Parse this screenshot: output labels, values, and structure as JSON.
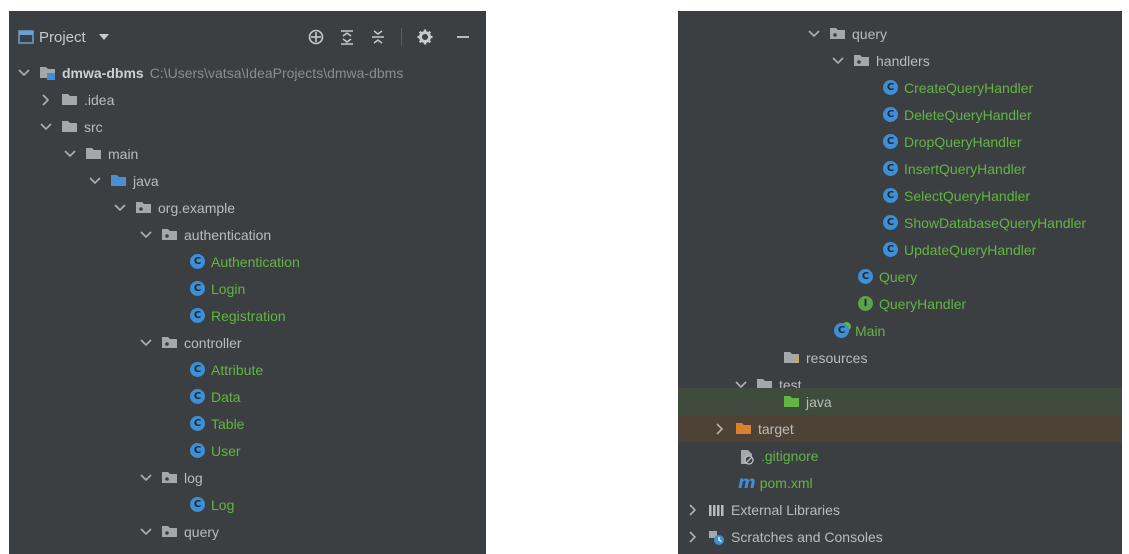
{
  "left": {
    "toolbar": {
      "title": "Project",
      "icons": [
        "project-view-icon",
        "dropdown-arrow-icon",
        "locate-icon",
        "expand-all-icon",
        "collapse-all-icon",
        "gear-icon",
        "minimize-icon"
      ]
    },
    "rows": [
      {
        "label": "dmwa-dbms",
        "path": "C:\\Users\\vatsa\\IdeaProjects\\dmwa-dbms"
      },
      {
        "label": ".idea"
      },
      {
        "label": "src"
      },
      {
        "label": "main"
      },
      {
        "label": "java"
      },
      {
        "label": "org.example"
      },
      {
        "label": "authentication"
      },
      {
        "label": "Authentication"
      },
      {
        "label": "Login"
      },
      {
        "label": "Registration"
      },
      {
        "label": "controller"
      },
      {
        "label": "Attribute"
      },
      {
        "label": "Data"
      },
      {
        "label": "Table"
      },
      {
        "label": "User"
      },
      {
        "label": "log"
      },
      {
        "label": "Log"
      },
      {
        "label": "query"
      }
    ]
  },
  "right": {
    "rows": [
      {
        "label": "query"
      },
      {
        "label": "handlers"
      },
      {
        "label": "CreateQueryHandler"
      },
      {
        "label": "DeleteQueryHandler"
      },
      {
        "label": "DropQueryHandler"
      },
      {
        "label": "InsertQueryHandler"
      },
      {
        "label": "SelectQueryHandler"
      },
      {
        "label": "ShowDatabaseQueryHandler"
      },
      {
        "label": "UpdateQueryHandler"
      },
      {
        "label": "Query"
      },
      {
        "label": "QueryHandler"
      },
      {
        "label": "Main"
      },
      {
        "label": "resources"
      },
      {
        "label": "test"
      },
      {
        "label": "java"
      },
      {
        "label": "target"
      },
      {
        "label": ".gitignore"
      },
      {
        "label": "pom.xml"
      },
      {
        "label": "External Libraries"
      },
      {
        "label": "Scratches and Consoles"
      }
    ]
  },
  "colors": {
    "panel_bg": "#3c3f41",
    "text": "#bbbbbb",
    "class_green": "#62b543",
    "target_orange": "#d9822b",
    "class_icon_blue": "#3d8fd6",
    "test_row_highlight": "#3f4b3c",
    "target_row_highlight": "#4e4236"
  }
}
